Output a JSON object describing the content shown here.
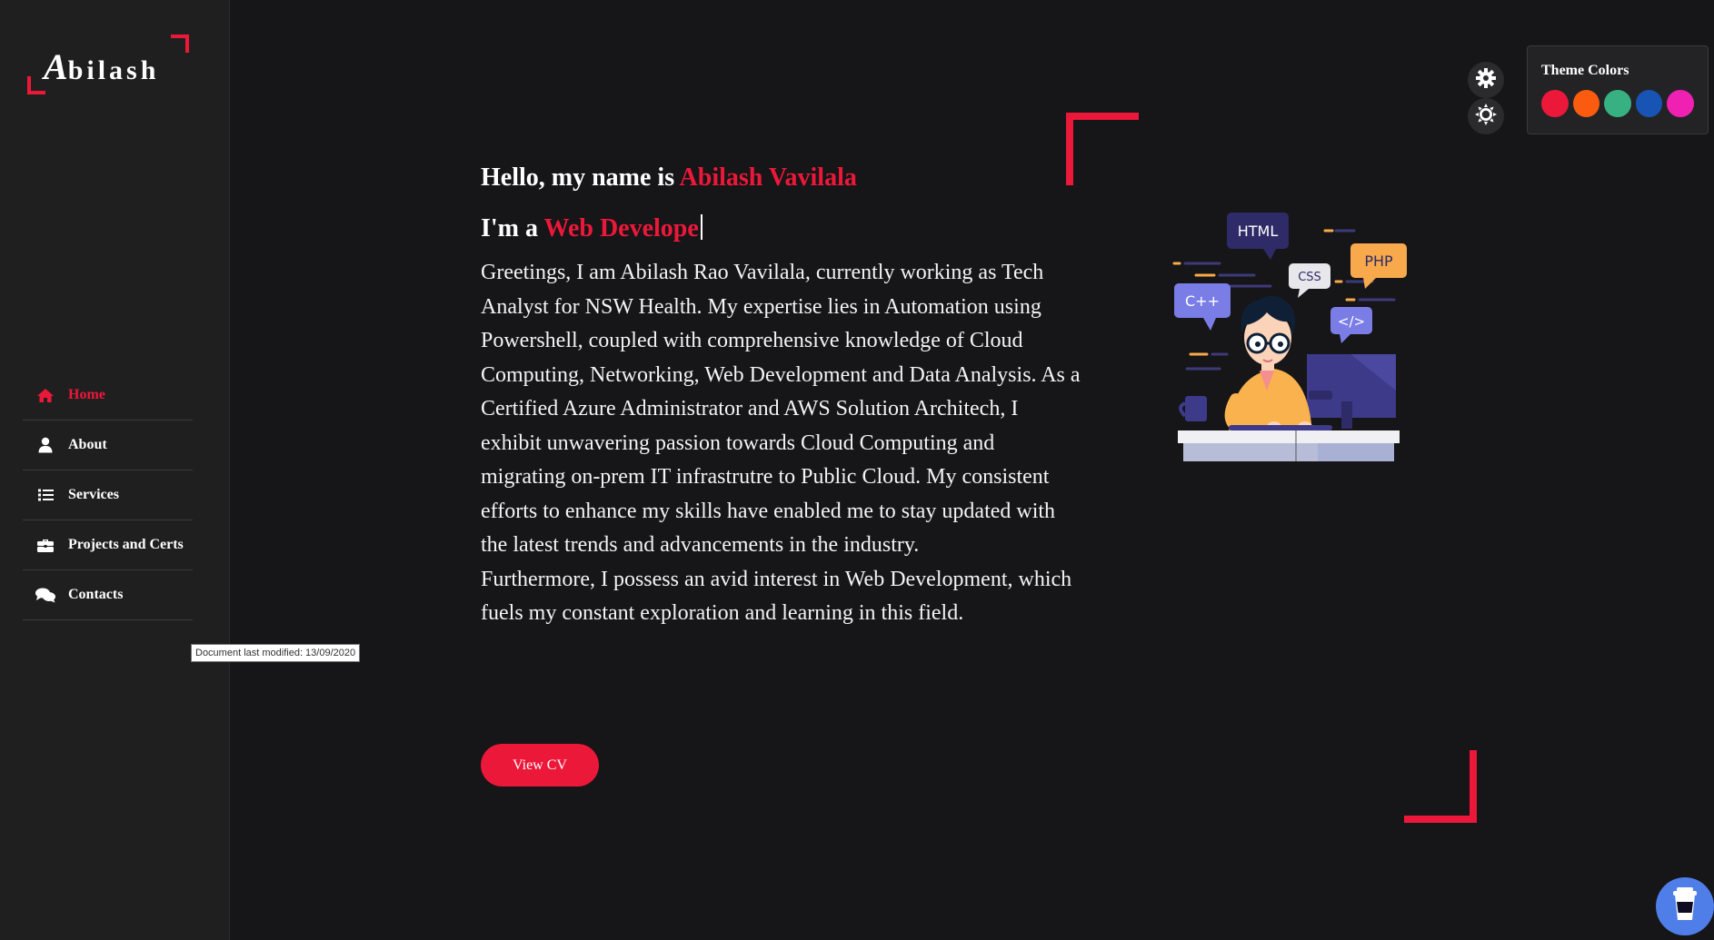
{
  "colors": {
    "accent": "#ec1839",
    "background": "#161517",
    "sidebar": "#1f1f20"
  },
  "logo": {
    "initial": "A",
    "rest": "bilash"
  },
  "nav": {
    "items": [
      {
        "label": "Home",
        "icon": "home-icon",
        "active": true
      },
      {
        "label": "About",
        "icon": "user-icon",
        "active": false
      },
      {
        "label": "Services",
        "icon": "list-icon",
        "active": false
      },
      {
        "label": "Projects and Certs",
        "icon": "briefcase-icon",
        "active": false
      },
      {
        "label": "Contacts",
        "icon": "comments-icon",
        "active": false
      }
    ]
  },
  "tooltip": "Document last modified: 13/09/2020",
  "home": {
    "greeting_prefix": "Hello, my name is ",
    "name": "Abilash Vavilala",
    "role_prefix": "I'm a ",
    "role_typed": "Web Develope",
    "bio_1": "Greetings, I am Abilash Rao Vavilala, currently working as Tech Analyst for NSW Health. My expertise lies in Automation using Powershell, coupled with comprehensive knowledge of Cloud Computing, Networking, Web Development and Data Analysis. As a Certified Azure Administrator and AWS Solution Architech, I exhibit unwavering passion towards Cloud Computing and migrating on-prem IT infrastrutre to Public Cloud. My consistent efforts to enhance my skills have enabled me to stay updated with the latest trends and advancements in the industry.",
    "bio_2": "Furthermore, I possess an avid interest in Web Development, which fuels my constant exploration and learning in this field.",
    "cv_button": "View CV"
  },
  "illustration": {
    "bubbles": [
      "HTML",
      "CSS",
      "PHP",
      "C++",
      "</>"
    ]
  },
  "theme_panel": {
    "title": "Theme Colors",
    "swatches": [
      "#ec1839",
      "#fa5b0f",
      "#37b182",
      "#1854b4",
      "#f021b2"
    ]
  },
  "buttons": {
    "settings": "gear-icon",
    "theme_toggle": "sun-icon",
    "coffee": "coffee-cup-icon"
  }
}
